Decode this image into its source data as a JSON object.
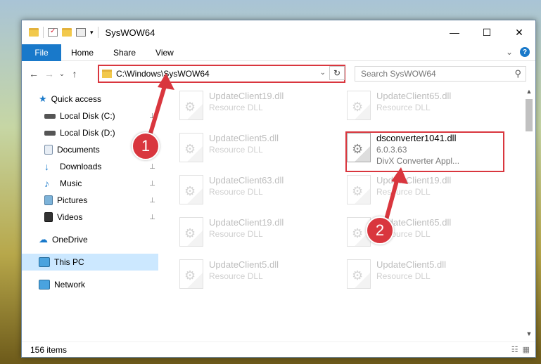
{
  "window": {
    "title": "SysWOW64",
    "min_label": "—",
    "max_label": "☐",
    "close_label": "✕"
  },
  "ribbon": {
    "tabs": [
      "File",
      "Home",
      "Share",
      "View"
    ],
    "expand_label": "⌄",
    "help_label": "?"
  },
  "nav": {
    "back": "←",
    "forward": "→",
    "recent": "⌄",
    "up": "↑",
    "address": "C:\\Windows\\SysWOW64",
    "address_dropdown": "⌄",
    "refresh": "↻",
    "search_placeholder": "Search SysWOW64",
    "search_icon": "⚲"
  },
  "sidebar": {
    "quick_access": "Quick access",
    "items": [
      {
        "label": "Local Disk (C:)",
        "icon": "drive-icon",
        "pinned": true
      },
      {
        "label": "Local Disk (D:)",
        "icon": "drive-icon",
        "pinned": false
      },
      {
        "label": "Documents",
        "icon": "documents-icon",
        "pinned": true
      },
      {
        "label": "Downloads",
        "icon": "downloads-icon",
        "pinned": true
      },
      {
        "label": "Music",
        "icon": "music-icon",
        "pinned": true
      },
      {
        "label": "Pictures",
        "icon": "pictures-icon",
        "pinned": true
      },
      {
        "label": "Videos",
        "icon": "videos-icon",
        "pinned": true
      }
    ],
    "onedrive": "OneDrive",
    "this_pc": "This PC",
    "network": "Network",
    "pin_glyph": "📌"
  },
  "files": [
    {
      "name": "UpdateClient19.dll",
      "sub": "Resource DLL",
      "faded": true
    },
    {
      "name": "UpdateClient65.dll",
      "sub": "Resource DLL",
      "faded": true
    },
    {
      "name": "UpdateClient5.dll",
      "sub": "Resource DLL",
      "faded": true
    },
    {
      "name": "dsconverter1041.dll",
      "sub": "6.0.3.63",
      "sub2": "DivX Converter Appl...",
      "faded": false
    },
    {
      "name": "UpdateClient63.dll",
      "sub": "Resource DLL",
      "faded": true
    },
    {
      "name": "UpdateClient19.dll",
      "sub": "Resource DLL",
      "faded": true
    },
    {
      "name": "UpdateClient19.dll",
      "sub": "Resource DLL",
      "faded": true
    },
    {
      "name": "UpdateClient65.dll",
      "sub": "Resource DLL",
      "faded": true
    },
    {
      "name": "UpdateClient5.dll",
      "sub": "Resource DLL",
      "faded": true
    },
    {
      "name": "UpdateClient5.dll",
      "sub": "Resource DLL",
      "faded": true
    }
  ],
  "status": {
    "count": "156 items"
  },
  "annotations": {
    "badge1": "1",
    "badge2": "2",
    "highlight_color": "#d9363e"
  }
}
